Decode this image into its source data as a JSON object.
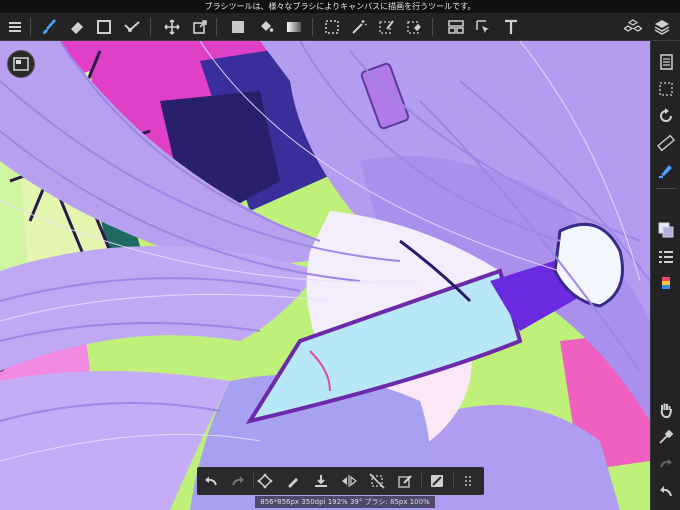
{
  "hint": {
    "text": "ブラシツールは、様々なブラシによりキャンバスに描画を行うツールです。"
  },
  "status": {
    "text": "856*856px 350dpi 192% 39° ブラシ: 85px 100%"
  },
  "colors": {
    "toolbar_bg": "#232325",
    "icon": "#d0d0d0",
    "active_icon": "#4aa3ff",
    "hint_bg": "#111111"
  },
  "toolbar": {
    "items": [
      "menu-icon",
      "brush-icon",
      "eraser-icon",
      "rectangle-icon",
      "ruler-icon",
      "move-icon",
      "transform-icon",
      "color-swatch-icon",
      "bucket-icon",
      "gradient-icon",
      "selection-icon",
      "magic-wand-icon",
      "select-pen-icon",
      "select-eraser-icon",
      "filter-icon",
      "pointer-icon",
      "text-icon",
      "materials-icon",
      "layers-icon"
    ]
  },
  "right_bar": {
    "items": [
      "pages-icon",
      "selection-dots-icon",
      "rotate-icon",
      "ruler-icon",
      "highlighter-icon",
      "layer-color-icon",
      "layer-list-icon",
      "color-palette-icon",
      "hand-icon",
      "eyedropper-icon",
      "redo-icon",
      "undo-icon"
    ]
  },
  "bottom_bar": {
    "items": [
      "undo-icon",
      "redo-icon",
      "transform-icon",
      "pen-icon",
      "save-icon",
      "flip-icon",
      "deselect-icon",
      "edit-icon",
      "clear-icon",
      "more-icon"
    ]
  }
}
